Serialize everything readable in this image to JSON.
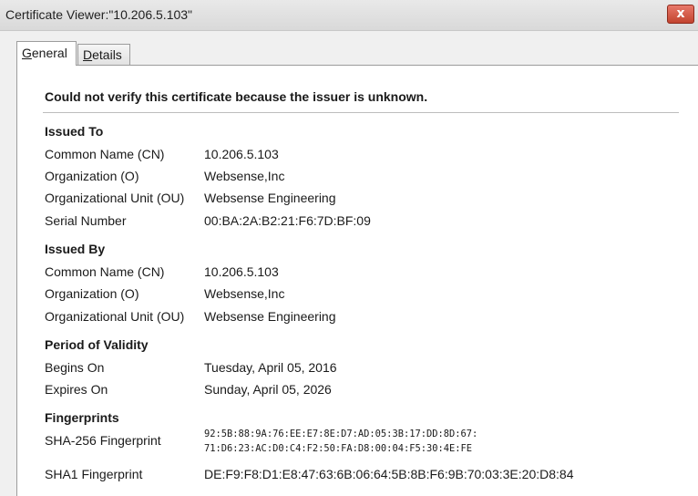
{
  "window": {
    "title": "Certificate Viewer:\"10.206.5.103\"",
    "close_label": "x"
  },
  "tabs": {
    "general_accel": "G",
    "general_rest": "eneral",
    "details_accel": "D",
    "details_rest": "etails"
  },
  "general": {
    "warning": "Could not verify this certificate because the issuer is unknown.",
    "issued_to": {
      "title": "Issued To",
      "cn_label": "Common Name (CN)",
      "cn_value": "10.206.5.103",
      "org_label": "Organization (O)",
      "org_value": "Websense,Inc",
      "ou_label": "Organizational Unit (OU)",
      "ou_value": "Websense Engineering",
      "serial_label": "Serial Number",
      "serial_value": "00:BA:2A:B2:21:F6:7D:BF:09"
    },
    "issued_by": {
      "title": "Issued By",
      "cn_label": "Common Name (CN)",
      "cn_value": "10.206.5.103",
      "org_label": "Organization (O)",
      "org_value": "Websense,Inc",
      "ou_label": "Organizational Unit (OU)",
      "ou_value": "Websense Engineering"
    },
    "validity": {
      "title": "Period of Validity",
      "begins_label": "Begins On",
      "begins_value": "Tuesday, April 05, 2016",
      "expires_label": "Expires On",
      "expires_value": "Sunday, April 05, 2026"
    },
    "fingerprints": {
      "title": "Fingerprints",
      "sha256_label": "SHA-256 Fingerprint",
      "sha256_line1": "92:5B:88:9A:76:EE:E7:8E:D7:AD:05:3B:17:DD:8D:67:",
      "sha256_line2": "71:D6:23:AC:D0:C4:F2:50:FA:D8:00:04:F5:30:4E:FE",
      "sha1_label": "SHA1 Fingerprint",
      "sha1_value": "DE:F9:F8:D1:E8:47:63:6B:06:64:5B:8B:F6:9B:70:03:3E:20:D8:84"
    }
  }
}
